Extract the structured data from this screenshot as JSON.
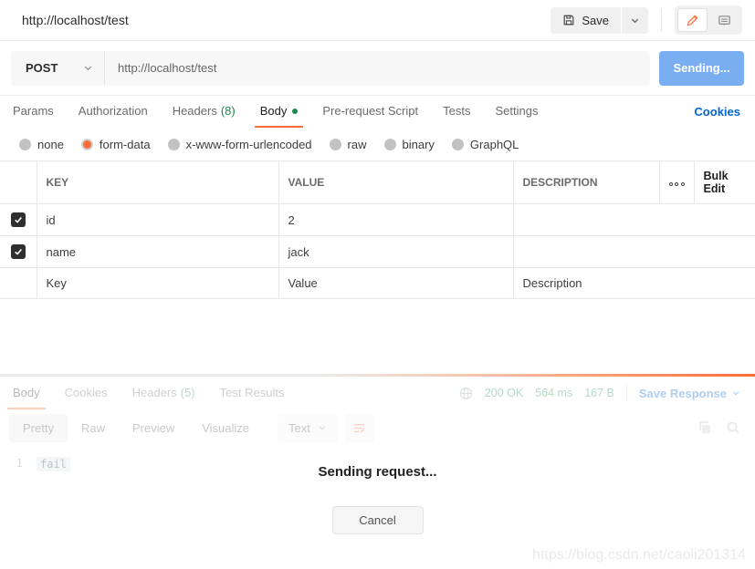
{
  "topbar": {
    "title": "http://localhost/test",
    "save_label": "Save"
  },
  "request": {
    "method": "POST",
    "url": "http://localhost/test",
    "send_label": "Sending..."
  },
  "request_tabs": {
    "params": "Params",
    "authorization": "Authorization",
    "headers": "Headers",
    "headers_count": "(8)",
    "body": "Body",
    "pre_request": "Pre-request Script",
    "tests": "Tests",
    "settings": "Settings",
    "cookies": "Cookies"
  },
  "body_types": {
    "none": "none",
    "form_data": "form-data",
    "urlencoded": "x-www-form-urlencoded",
    "raw": "raw",
    "binary": "binary",
    "graphql": "GraphQL"
  },
  "table": {
    "headers": {
      "key": "KEY",
      "value": "VALUE",
      "description": "DESCRIPTION",
      "bulk_edit": "Bulk Edit"
    },
    "rows": [
      {
        "key": "id",
        "value": "2"
      },
      {
        "key": "name",
        "value": "jack"
      }
    ],
    "placeholders": {
      "key": "Key",
      "value": "Value",
      "description": "Description"
    }
  },
  "response": {
    "tabs": {
      "body": "Body",
      "cookies": "Cookies",
      "headers": "Headers",
      "headers_count": "(5)",
      "test_results": "Test Results"
    },
    "status": "200 OK",
    "time": "564 ms",
    "size": "167 B",
    "save_response": "Save Response",
    "views": {
      "pretty": "Pretty",
      "raw": "Raw",
      "preview": "Preview",
      "visualize": "Visualize"
    },
    "format": "Text",
    "line_number": "1",
    "code": "fail"
  },
  "overlay": {
    "message": "Sending request...",
    "cancel_label": "Cancel"
  },
  "watermark": "https://blog.csdn.net/caoli201314",
  "colors": {
    "accent": "#ff6c37",
    "green": "#1a8a4a",
    "link_blue": "#0265d2",
    "sending_blue": "#79aff1"
  }
}
